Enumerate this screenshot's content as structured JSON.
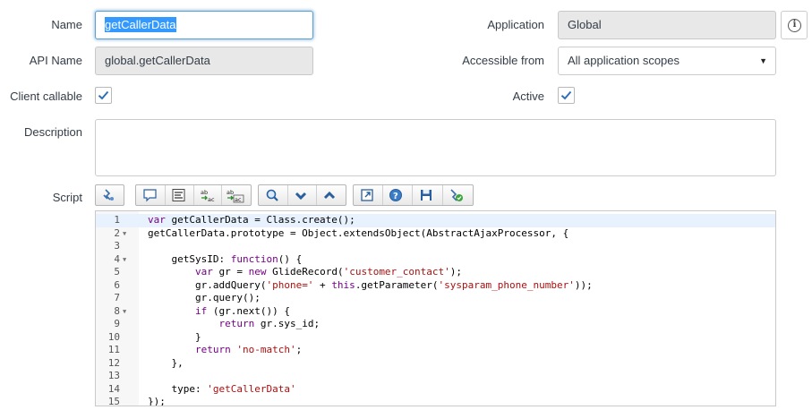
{
  "form": {
    "name_label": "Name",
    "name_value": "getCallerData",
    "api_name_label": "API Name",
    "api_name_value": "global.getCallerData",
    "client_callable_label": "Client callable",
    "client_callable_checked": true,
    "description_label": "Description",
    "description_value": "",
    "script_label": "Script",
    "application_label": "Application",
    "application_value": "Global",
    "accessible_from_label": "Accessible from",
    "accessible_from_value": "All application scopes",
    "active_label": "Active",
    "active_checked": true
  },
  "icons": {
    "info": "info-icon",
    "dropdown": "dropdown-caret-icon",
    "check": "checkmark-icon"
  },
  "toolbar": {
    "buttons": [
      "toggle-syntax-icon",
      "comment-icon",
      "format-icon",
      "replace-icon",
      "replace-all-icon",
      "search-icon",
      "find-next-icon",
      "find-previous-icon",
      "fullscreen-icon",
      "help-icon",
      "save-icon",
      "script-debugger-icon"
    ]
  },
  "colors": {
    "focus_blue": "#5a9fd6",
    "check_blue": "#2f6fb5",
    "keyword": "#770088",
    "string": "#aa1111"
  },
  "code": {
    "lines": [
      {
        "n": "1",
        "fold": false,
        "parts": [
          [
            "kw",
            "var"
          ],
          [
            "t",
            " getCallerData = Class.create();"
          ]
        ]
      },
      {
        "n": "2",
        "fold": true,
        "parts": [
          [
            "t",
            "getCallerData.prototype = Object.extendsObject(AbstractAjaxProcessor, {"
          ]
        ]
      },
      {
        "n": "3",
        "fold": false,
        "parts": []
      },
      {
        "n": "4",
        "fold": true,
        "parts": [
          [
            "t",
            "    getSysID: "
          ],
          [
            "kw",
            "function"
          ],
          [
            "t",
            "() {"
          ]
        ]
      },
      {
        "n": "5",
        "fold": false,
        "parts": [
          [
            "t",
            "        "
          ],
          [
            "kw",
            "var"
          ],
          [
            "t",
            " gr = "
          ],
          [
            "kw",
            "new"
          ],
          [
            "t",
            " GlideRecord("
          ],
          [
            "str",
            "'customer_contact'"
          ],
          [
            "t",
            ");"
          ]
        ]
      },
      {
        "n": "6",
        "fold": false,
        "parts": [
          [
            "t",
            "        gr.addQuery("
          ],
          [
            "str",
            "'phone='"
          ],
          [
            "t",
            " + "
          ],
          [
            "kw",
            "this"
          ],
          [
            "t",
            ".getParameter("
          ],
          [
            "str",
            "'sysparam_phone_number'"
          ],
          [
            "t",
            "));"
          ]
        ]
      },
      {
        "n": "7",
        "fold": false,
        "parts": [
          [
            "t",
            "        gr.query();"
          ]
        ]
      },
      {
        "n": "8",
        "fold": true,
        "parts": [
          [
            "t",
            "        "
          ],
          [
            "kw",
            "if"
          ],
          [
            "t",
            " (gr.next()) {"
          ]
        ]
      },
      {
        "n": "9",
        "fold": false,
        "parts": [
          [
            "t",
            "            "
          ],
          [
            "kw",
            "return"
          ],
          [
            "t",
            " gr.sys_id;"
          ]
        ]
      },
      {
        "n": "10",
        "fold": false,
        "parts": [
          [
            "t",
            "        }"
          ]
        ]
      },
      {
        "n": "11",
        "fold": false,
        "parts": [
          [
            "t",
            "        "
          ],
          [
            "kw",
            "return"
          ],
          [
            "t",
            " "
          ],
          [
            "str",
            "'no-match'"
          ],
          [
            "t",
            ";"
          ]
        ]
      },
      {
        "n": "12",
        "fold": false,
        "parts": [
          [
            "t",
            "    },"
          ]
        ]
      },
      {
        "n": "13",
        "fold": false,
        "parts": []
      },
      {
        "n": "14",
        "fold": false,
        "parts": [
          [
            "t",
            "    type: "
          ],
          [
            "str",
            "'getCallerData'"
          ]
        ]
      },
      {
        "n": "15",
        "fold": false,
        "parts": [
          [
            "t",
            "});"
          ]
        ]
      }
    ]
  }
}
